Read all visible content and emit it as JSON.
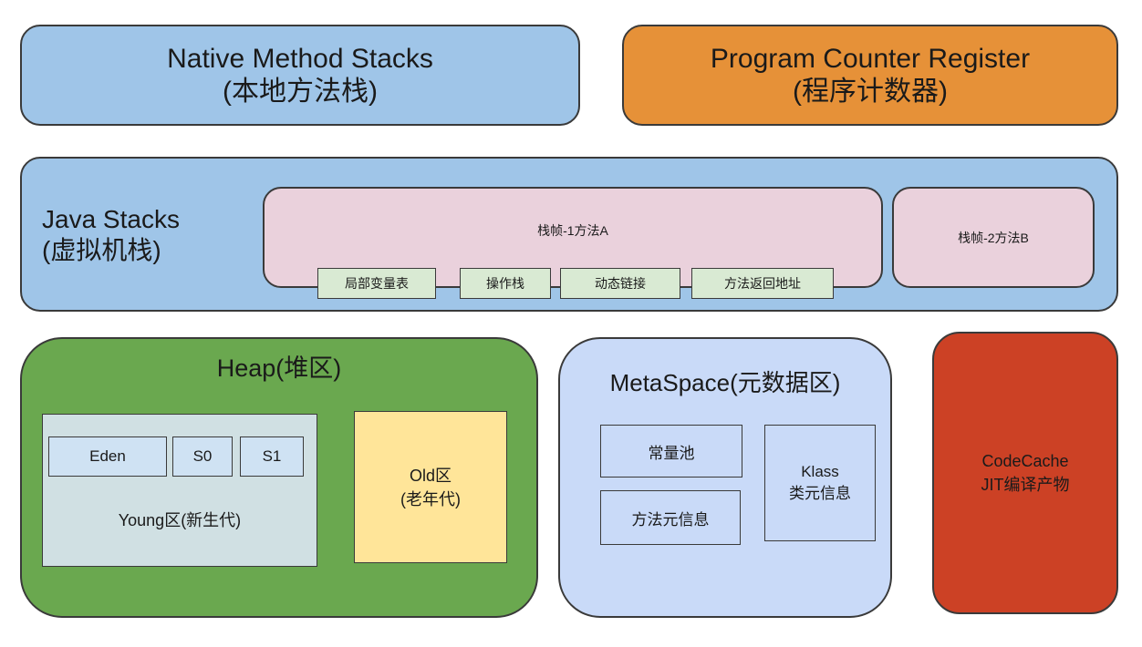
{
  "native_method_stacks": {
    "title": "Native Method Stacks",
    "subtitle": "(本地方法栈)"
  },
  "program_counter_register": {
    "title": "Program Counter Register",
    "subtitle": "(程序计数器)"
  },
  "java_stacks": {
    "title": "Java Stacks",
    "subtitle": "(虚拟机栈)",
    "frame1": {
      "label": "栈帧-1方法A",
      "slots": [
        "局部变量表",
        "操作栈",
        "动态链接",
        "方法返回地址"
      ]
    },
    "frame2": {
      "label": "栈帧-2方法B"
    }
  },
  "heap": {
    "title": "Heap(堆区)",
    "young": {
      "cells": [
        "Eden",
        "S0",
        "S1"
      ],
      "label": "Young区(新生代)"
    },
    "old": {
      "line1": "Old区",
      "line2": "(老年代)"
    }
  },
  "metaspace": {
    "title": "MetaSpace(元数据区)",
    "constant_pool": "常量池",
    "method_meta": "方法元信息",
    "klass": {
      "line1": "Klass",
      "line2": "类元信息"
    }
  },
  "codecache": {
    "line1": "CodeCache",
    "line2": "JIT编译产物"
  },
  "colors": {
    "blue": "#9fc5e8",
    "orange": "#e69138",
    "pink": "#ead1dc",
    "light_green": "#d9ead3",
    "green": "#6aa84f",
    "grey_blue": "#d0e0e3",
    "yellow": "#ffe599",
    "lavender_blue": "#c9daf8",
    "red": "#cc4125"
  }
}
